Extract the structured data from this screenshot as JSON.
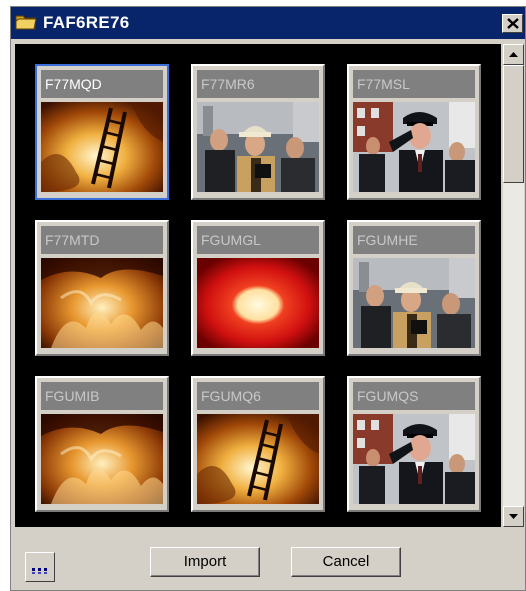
{
  "window": {
    "title": "FAF6RE76",
    "title_icon": "folder-icon",
    "close_icon": "close-icon",
    "colors": {
      "titlebar": "#08246b",
      "selection": "#3a6ed8"
    }
  },
  "thumbnails": [
    {
      "label": "F77MQD",
      "image": "fire-ladder",
      "selected": true
    },
    {
      "label": "F77MR6",
      "image": "firefighters-crowd",
      "selected": false
    },
    {
      "label": "F77MSL",
      "image": "officer-salute",
      "selected": false
    },
    {
      "label": "F77MTD",
      "image": "flames",
      "selected": false
    },
    {
      "label": "FGUMGL",
      "image": "red-glow",
      "selected": false
    },
    {
      "label": "FGUMHE",
      "image": "firefighters-crowd",
      "selected": false
    },
    {
      "label": "FGUMIB",
      "image": "flames",
      "selected": false
    },
    {
      "label": "FGUMQ6",
      "image": "fire-ladder",
      "selected": false
    },
    {
      "label": "FGUMQS",
      "image": "officer-salute",
      "selected": false
    }
  ],
  "scrollbar": {
    "up_icon": "arrow-up-icon",
    "down_icon": "arrow-down-icon"
  },
  "buttons": {
    "import": "Import",
    "cancel": "Cancel",
    "options_icon": "ellipsis-icon"
  }
}
